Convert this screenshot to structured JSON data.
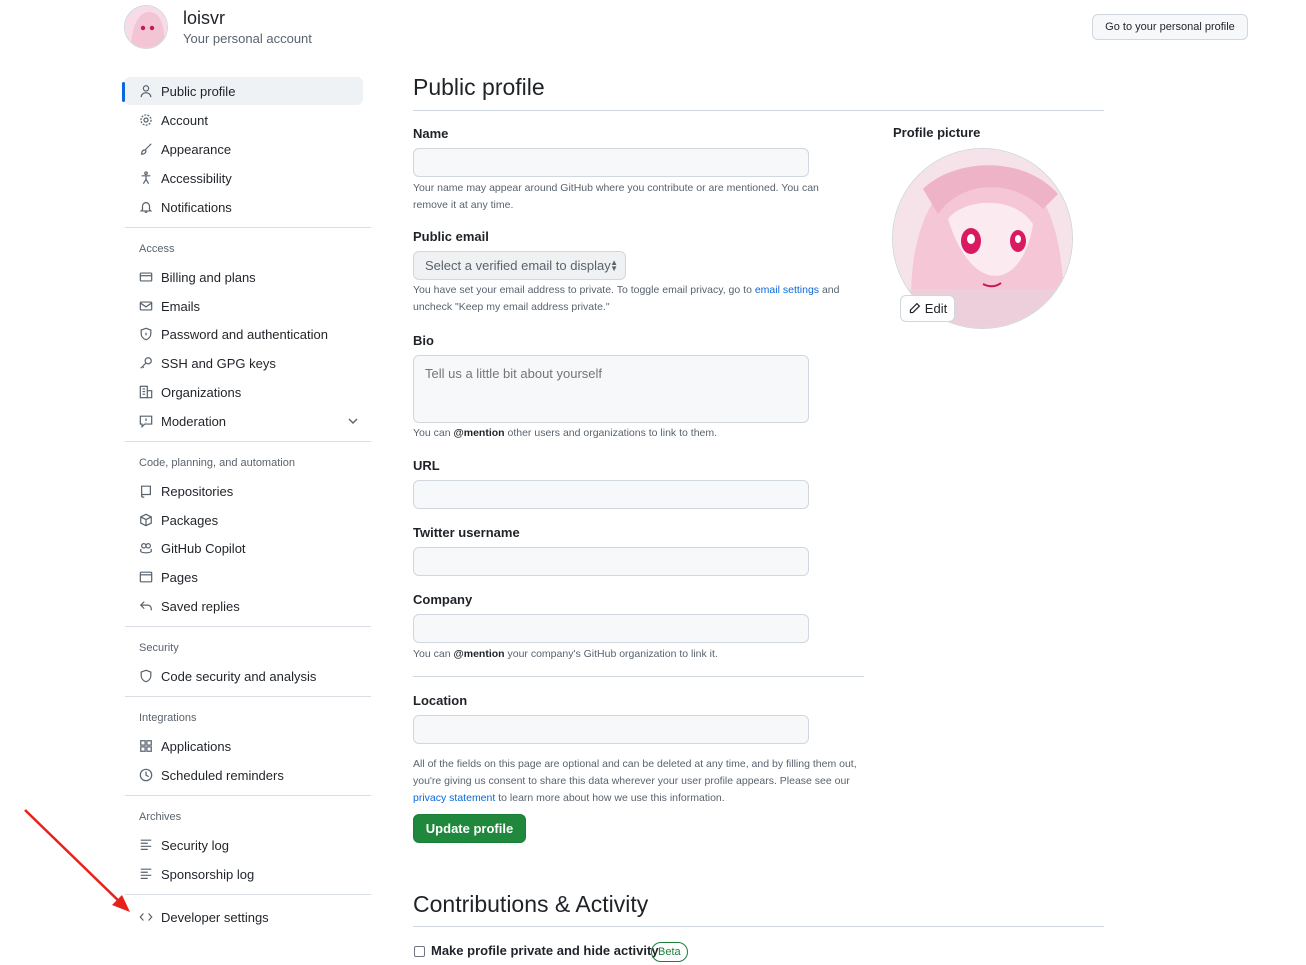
{
  "header": {
    "username": "loisvr",
    "subtitle": "Your personal account",
    "profile_button": "Go to your personal profile"
  },
  "sidebar": {
    "items_top": [
      {
        "label": "Public profile",
        "icon": "person-icon",
        "active": true
      },
      {
        "label": "Account",
        "icon": "gear-icon"
      },
      {
        "label": "Appearance",
        "icon": "paintbrush-icon"
      },
      {
        "label": "Accessibility",
        "icon": "accessibility-icon"
      },
      {
        "label": "Notifications",
        "icon": "bell-icon"
      }
    ],
    "access_heading": "Access",
    "access": [
      {
        "label": "Billing and plans",
        "icon": "credit-card-icon"
      },
      {
        "label": "Emails",
        "icon": "mail-icon"
      },
      {
        "label": "Password and authentication",
        "icon": "shield-lock-icon"
      },
      {
        "label": "SSH and GPG keys",
        "icon": "key-icon"
      },
      {
        "label": "Organizations",
        "icon": "organization-icon"
      },
      {
        "label": "Moderation",
        "icon": "report-icon"
      }
    ],
    "code_heading": "Code, planning, and automation",
    "code": [
      {
        "label": "Repositories",
        "icon": "repo-icon"
      },
      {
        "label": "Packages",
        "icon": "package-icon"
      },
      {
        "label": "GitHub Copilot",
        "icon": "copilot-icon"
      },
      {
        "label": "Pages",
        "icon": "browser-icon"
      },
      {
        "label": "Saved replies",
        "icon": "reply-icon"
      }
    ],
    "security_heading": "Security",
    "security": [
      {
        "label": "Code security and analysis",
        "icon": "shield-icon"
      }
    ],
    "integrations_heading": "Integrations",
    "integrations": [
      {
        "label": "Applications",
        "icon": "apps-icon"
      },
      {
        "label": "Scheduled reminders",
        "icon": "clock-icon"
      }
    ],
    "archives_heading": "Archives",
    "archives": [
      {
        "label": "Security log",
        "icon": "log-icon"
      },
      {
        "label": "Sponsorship log",
        "icon": "log-icon"
      }
    ],
    "developer": {
      "label": "Developer settings",
      "icon": "code-icon"
    }
  },
  "main": {
    "title": "Public profile",
    "name_label": "Name",
    "name_value": "",
    "name_note": "Your name may appear around GitHub where you contribute or are mentioned. You can remove it at any time.",
    "email_label": "Public email",
    "email_select": "Select a verified email to display",
    "email_note_1": "You have set your email address to private. To toggle email privacy, go to",
    "email_note_link": "email settings",
    "email_note_2": "and uncheck \"Keep my email address private.\"",
    "bio_label": "Bio",
    "bio_placeholder": "Tell us a little bit about yourself",
    "bio_note_1": "You can",
    "bio_note_mention": "@mention",
    "bio_note_2": "other users and organizations to link to them.",
    "url_label": "URL",
    "twitter_label": "Twitter username",
    "company_label": "Company",
    "company_note_1": "You can",
    "company_note_mention": "@mention",
    "company_note_2": "your company's GitHub organization to link it.",
    "location_label": "Location",
    "footer_note_1": "All of the fields on this page are optional and can be deleted at any time, and by filling them out, you're giving us consent to share this data wherever your user profile appears. Please see our",
    "footer_note_link": "privacy statement",
    "footer_note_2": "to learn more about how we use this information.",
    "update_button": "Update profile",
    "contrib_title": "Contributions & Activity",
    "private_checkbox": "Make profile private and hide activity",
    "beta_badge": "Beta"
  },
  "profile_picture": {
    "label": "Profile picture",
    "edit_button": "Edit"
  }
}
